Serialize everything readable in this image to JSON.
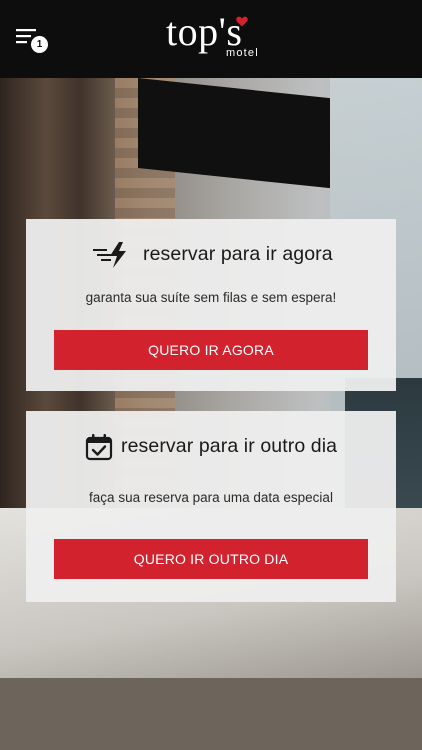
{
  "header": {
    "menu_icon": "menu-icon",
    "notification_count": "1",
    "logo_main": "top's",
    "logo_sub": "motel",
    "logo_accent_color": "#d1222e"
  },
  "cards": [
    {
      "icon": "lightning-icon",
      "title": "reservar para ir agora",
      "subtitle": "garanta sua suíte sem filas e sem espera!",
      "button_label": "QUERO IR AGORA"
    },
    {
      "icon": "calendar-check-icon",
      "title": "reservar para ir outro dia",
      "subtitle": "faça sua reserva para uma data especial",
      "button_label": "QUERO IR OUTRO DIA"
    }
  ],
  "colors": {
    "header_bg": "#0d0d0d",
    "button_red": "#d1222e",
    "card_bg": "#eeeeee"
  }
}
